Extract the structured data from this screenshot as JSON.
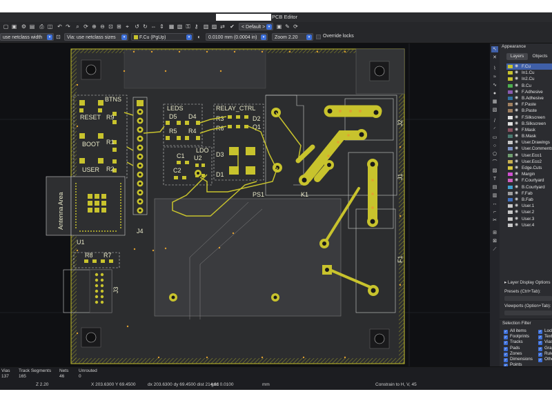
{
  "window": {
    "title": "PCB Editor"
  },
  "toolbar": {
    "track_width": "use netclass width",
    "via_size": "Via: use netclass sizes",
    "layer": "F.Cu (PgUp)",
    "grid": "0.0100 mm (0.0004 in)",
    "zoom": "Zoom 2.20",
    "preset": "< Default >",
    "override_locks": "Override locks"
  },
  "pcb": {
    "refs": {
      "btns": "BTNS",
      "reset": "RESET",
      "boot": "BOOT",
      "user": "USER",
      "r9": "R9",
      "r1": "R1",
      "r2": "R2",
      "leds": "LEDS",
      "d5": "D5",
      "d4": "D4",
      "r5": "R5",
      "r4": "R4",
      "relay_ctrl": "RELAY_CTRL",
      "r3": "R3",
      "d2": "D2",
      "r6": "R6",
      "q1": "Q1",
      "d3": "D3",
      "d1": "D1",
      "ldo": "LDO",
      "c1": "C1",
      "u2": "U2",
      "c2": "C2",
      "antenna": "Antenna Area",
      "u1": "U1",
      "j4": "J4",
      "r8": "R8",
      "r7": "R7",
      "j3": "J3",
      "ps1": "PS1",
      "k1": "K1",
      "j2": "J2",
      "j1": "J1",
      "f1": "F1"
    }
  },
  "appearance": {
    "title": "Appearance",
    "tabs": [
      "Layers",
      "Objects"
    ],
    "layers": [
      {
        "name": "F.Cu",
        "color": "#c8c32d"
      },
      {
        "name": "In1.Cu",
        "color": "#c8c32d"
      },
      {
        "name": "In2.Cu",
        "color": "#c8c32d"
      },
      {
        "name": "B.Cu",
        "color": "#4db050"
      },
      {
        "name": "F.Adhesive",
        "color": "#8a5ab0"
      },
      {
        "name": "B.Adhesive",
        "color": "#3070a0"
      },
      {
        "name": "F.Paste",
        "color": "#a08060"
      },
      {
        "name": "B.Paste",
        "color": "#a08060"
      },
      {
        "name": "F.Silkscreen",
        "color": "#e0e0e0"
      },
      {
        "name": "B.Silkscreen",
        "color": "#e0e0e0"
      },
      {
        "name": "F.Mask",
        "color": "#8a5060"
      },
      {
        "name": "B.Mask",
        "color": "#4a7a70"
      },
      {
        "name": "User.Drawings",
        "color": "#c8c8c8"
      },
      {
        "name": "User.Comments",
        "color": "#7a90c0"
      },
      {
        "name": "User.Eco1",
        "color": "#70a070"
      },
      {
        "name": "User.Eco2",
        "color": "#c8b050"
      },
      {
        "name": "Edge.Cuts",
        "color": "#d8c840"
      },
      {
        "name": "Margin",
        "color": "#d050d0"
      },
      {
        "name": "F.Courtyard",
        "color": "#d060c0"
      },
      {
        "name": "B.Courtyard",
        "color": "#40a0d0"
      },
      {
        "name": "F.Fab",
        "color": "#a0a0a0"
      },
      {
        "name": "B.Fab",
        "color": "#4070c0"
      },
      {
        "name": "User.1",
        "color": "#c8c8c8"
      },
      {
        "name": "User.2",
        "color": "#c8c8c8"
      },
      {
        "name": "User.3",
        "color": "#c8c8c8"
      },
      {
        "name": "User.4",
        "color": "#c8c8c8"
      }
    ],
    "layer_display_options": "Layer Display Options",
    "presets_label": "Presets (Ctrl+Tab):",
    "viewports_label": "Viewports (Option+Tab):",
    "selection_filter": "Selection Filter",
    "filters_left": [
      "All items",
      "Footprints",
      "Tracks",
      "Pads",
      "Zones",
      "Dimensions",
      "Points"
    ],
    "filters_right": [
      "Locked",
      "Text",
      "Vias",
      "Graphics",
      "Rule",
      "Other"
    ]
  },
  "status": {
    "vias_label": "Vias",
    "vias_value": "137",
    "tracks_label": "Track Segments",
    "tracks_value": "165",
    "nets_label": "Nets",
    "nets_value": "46",
    "unrouted_label": "Unrouted",
    "unrouted_value": "0",
    "zoom": "Z 2.20",
    "xy": "X 203.6300  Y 69.4500",
    "dxy": "dx 203.6300  dy 69.4500  dist 214.81",
    "grid": "grid 0.0100",
    "units": "mm",
    "constrain": "Constrain to H, V, 45"
  }
}
